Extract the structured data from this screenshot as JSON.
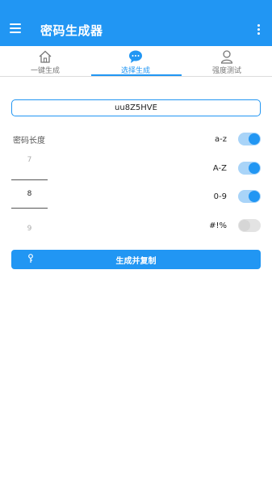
{
  "appbar": {
    "title": "密码生成器",
    "menu_icon": "hamburger-menu-icon",
    "more_icon": "more-vertical-icon",
    "background": "#2196F3"
  },
  "tabs": [
    {
      "label": "一键生成",
      "icon": "home-icon",
      "active": false
    },
    {
      "label": "选择生成",
      "icon": "chat-bubble-icon",
      "active": true
    },
    {
      "label": "强度测试",
      "icon": "user-icon",
      "active": false
    }
  ],
  "password": {
    "value": "uu8Z5HVE"
  },
  "length": {
    "label": "密码长度",
    "options": [
      "7",
      "8",
      "9"
    ],
    "selected": "8"
  },
  "toggles": [
    {
      "label": "a-z",
      "on": true
    },
    {
      "label": "A-Z",
      "on": true
    },
    {
      "label": "0-9",
      "on": true
    },
    {
      "label": "#!%",
      "on": false
    }
  ],
  "generate_button": {
    "label": "生成并复制",
    "icon": "key-icon"
  },
  "colors": {
    "accent": "#2196F3",
    "toggle_track_on": "#a9d4f8",
    "toggle_off": "#e3e3e3"
  }
}
